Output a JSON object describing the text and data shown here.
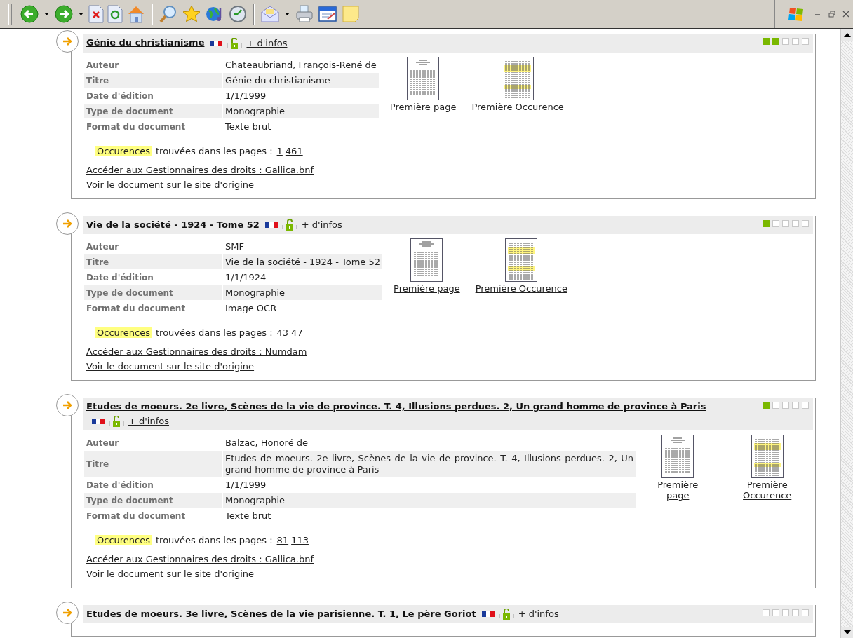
{
  "records": [
    {
      "title": "Génie du christianisme",
      "info_link": "+ d'infos",
      "stars": 2,
      "fields": [
        {
          "label": "Auteur",
          "value": "Chateaubriand, François-René de"
        },
        {
          "label": "Titre",
          "value": "Génie du christianisme"
        },
        {
          "label": "Date d'édition",
          "value": "1/1/1999"
        },
        {
          "label": "Type de document",
          "value": "Monographie"
        },
        {
          "label": "Format du document",
          "value": "Texte brut"
        }
      ],
      "thumbnails": [
        {
          "kind": "page",
          "label": "Première page"
        },
        {
          "kind": "occurrence",
          "label": "Première Occurence"
        }
      ],
      "occurrences": {
        "highlight": "Occurences",
        "text": "trouvées dans les pages :",
        "pages": [
          "1",
          "461"
        ]
      },
      "links": [
        "Accéder aux Gestionnaires des droits : Gallica.bnf",
        "Voir le document sur le site d'origine"
      ]
    },
    {
      "title": "Vie de la société - 1924 - Tome 52",
      "info_link": "+ d'infos",
      "stars": 1,
      "fields": [
        {
          "label": "Auteur",
          "value": "SMF"
        },
        {
          "label": "Titre",
          "value": "Vie de la société - 1924 - Tome 52"
        },
        {
          "label": "Date d'édition",
          "value": "1/1/1924"
        },
        {
          "label": "Type de document",
          "value": "Monographie"
        },
        {
          "label": "Format du document",
          "value": "Image OCR"
        }
      ],
      "thumbnails": [
        {
          "kind": "page",
          "label": "Première page"
        },
        {
          "kind": "occurrence",
          "label": "Première Occurence"
        }
      ],
      "occurrences": {
        "highlight": "Occurences",
        "text": "trouvées dans les pages :",
        "pages": [
          "43",
          "47"
        ]
      },
      "links": [
        "Accéder aux Gestionnaires des droits : Numdam",
        "Voir le document sur le site d'origine"
      ]
    },
    {
      "title": "Etudes de moeurs. 2e livre, Scènes de la vie de province. T. 4, Illusions perdues. 2, Un grand homme de province à Paris",
      "info_link": "+ d'infos",
      "stars": 1,
      "fields": [
        {
          "label": "Auteur",
          "value": "Balzac, Honoré de"
        },
        {
          "label": "Titre",
          "value": "Etudes de moeurs. 2e livre, Scènes de la vie de province. T. 4, Illusions perdues. 2, Un grand homme de province à Paris"
        },
        {
          "label": "Date d'édition",
          "value": "1/1/1999"
        },
        {
          "label": "Type de document",
          "value": "Monographie"
        },
        {
          "label": "Format du document",
          "value": "Texte brut"
        }
      ],
      "thumbnails": [
        {
          "kind": "page",
          "label": "Première page"
        },
        {
          "kind": "occurrence",
          "label": "Première Occurence"
        }
      ],
      "occurrences": {
        "highlight": "Occurences",
        "text": "trouvées dans les pages :",
        "pages": [
          "81",
          "113"
        ]
      },
      "links": [
        "Accéder aux Gestionnaires des droits : Gallica.bnf",
        "Voir le document sur le site d'origine"
      ]
    },
    {
      "title": "Etudes de moeurs. 3e livre, Scènes de la vie parisienne. T. 1, Le père Goriot",
      "info_link": "+ d'infos",
      "stars": 0
    }
  ]
}
